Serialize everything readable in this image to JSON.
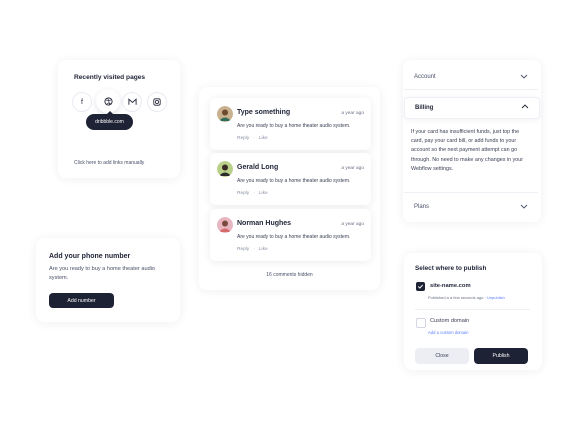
{
  "recent": {
    "title": "Recently visited pages",
    "icons": [
      "facebook-icon",
      "dribbble-icon",
      "gmail-icon",
      "instagram-icon"
    ],
    "tooltip": "dribbble.com",
    "manual_link": "Click here to add links manually"
  },
  "phone": {
    "title": "Add your phone number",
    "description": "Are you ready to buy a home theater audio system.",
    "button": "Add number"
  },
  "comments": {
    "items": [
      {
        "name": "Type something",
        "time": "a year ago",
        "text": "Are you ready to buy a home theater audio system.",
        "reply": "Reply",
        "like": "Like"
      },
      {
        "name": "Gerald Long",
        "time": "a year ago",
        "text": "Are you ready to buy a home theater audio system.",
        "reply": "Reply",
        "like": "Like"
      },
      {
        "name": "Norman Hughes",
        "time": "a year ago",
        "text": "Are you ready to buy a home theater audio system.",
        "reply": "Reply",
        "like": "Like"
      }
    ],
    "hidden_note": "16 comments hidden"
  },
  "accordion": {
    "account": "Account",
    "billing": "Billing",
    "billing_body": "If your card has insufficient funds, just top the card, pay your card bill, or add funds to your account so the next payment attempt can go through. No need to make any changes in your Webflow settings.",
    "plans": "Plans"
  },
  "publish": {
    "title": "Select where to publish",
    "site": "site-name.com",
    "published_info": "Published a a few seconds ago",
    "unpublish": "Unpublish",
    "custom": "Custom domain",
    "add_custom": "Add a custom domain",
    "close": "Close",
    "publish": "Publish"
  },
  "colors": {
    "dark": "#1e2235",
    "link": "#5b7fff"
  }
}
